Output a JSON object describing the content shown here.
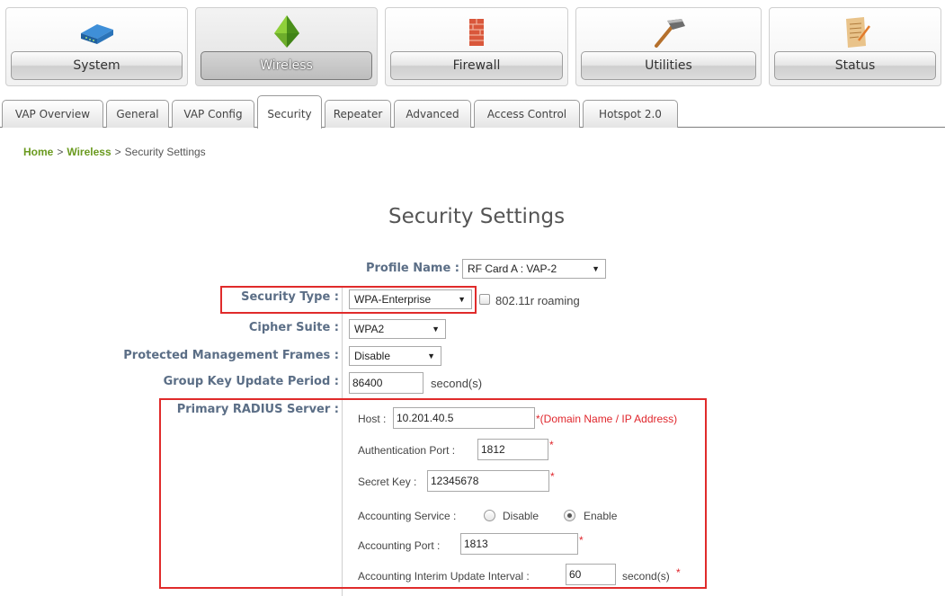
{
  "nav": {
    "items": [
      {
        "label": "System",
        "icon": "network-device-icon"
      },
      {
        "label": "Wireless",
        "icon": "wireless-icon"
      },
      {
        "label": "Firewall",
        "icon": "firewall-icon"
      },
      {
        "label": "Utilities",
        "icon": "hammer-icon"
      },
      {
        "label": "Status",
        "icon": "report-icon"
      }
    ],
    "active": "Wireless"
  },
  "tabs": {
    "items": [
      "VAP Overview",
      "General",
      "VAP Config",
      "Security",
      "Repeater",
      "Advanced",
      "Access Control",
      "Hotspot 2.0"
    ],
    "active": "Security"
  },
  "breadcrumb": {
    "home": "Home",
    "sep1": ">",
    "wireless": "Wireless",
    "sep2": ">",
    "current": "Security Settings"
  },
  "page_title": "Security Settings",
  "form": {
    "profile_name": {
      "label": "Profile Name :",
      "value": "RF Card A : VAP-2"
    },
    "security_type": {
      "label": "Security Type :",
      "value": "WPA-Enterprise",
      "roaming_label": "802.11r roaming",
      "roaming_checked": false
    },
    "cipher_suite": {
      "label": "Cipher Suite :",
      "value": "WPA2"
    },
    "pmf": {
      "label": "Protected Management Frames :",
      "value": "Disable"
    },
    "group_key": {
      "label": "Group Key Update Period :",
      "value": "86400",
      "unit": "second(s)"
    },
    "radius": {
      "label": "Primary RADIUS Server :",
      "host_label": "Host :",
      "host_value": "10.201.40.5",
      "host_hint": "*(Domain Name / IP Address)",
      "auth_port_label": "Authentication Port :",
      "auth_port_value": "1812",
      "secret_label": "Secret Key :",
      "secret_value": "12345678",
      "acct_service_label": "Accounting Service :",
      "acct_disable": "Disable",
      "acct_enable": "Enable",
      "acct_selected": "Enable",
      "acct_port_label": "Accounting Port :",
      "acct_port_value": "1813",
      "interim_label": "Accounting Interim Update Interval :",
      "interim_value": "60",
      "interim_unit": "second(s)",
      "required_mark": "*"
    }
  },
  "colors": {
    "highlight": "#e02b2b",
    "link": "#6a9a1f",
    "label": "#5b6e86",
    "required": "#e0262c"
  }
}
